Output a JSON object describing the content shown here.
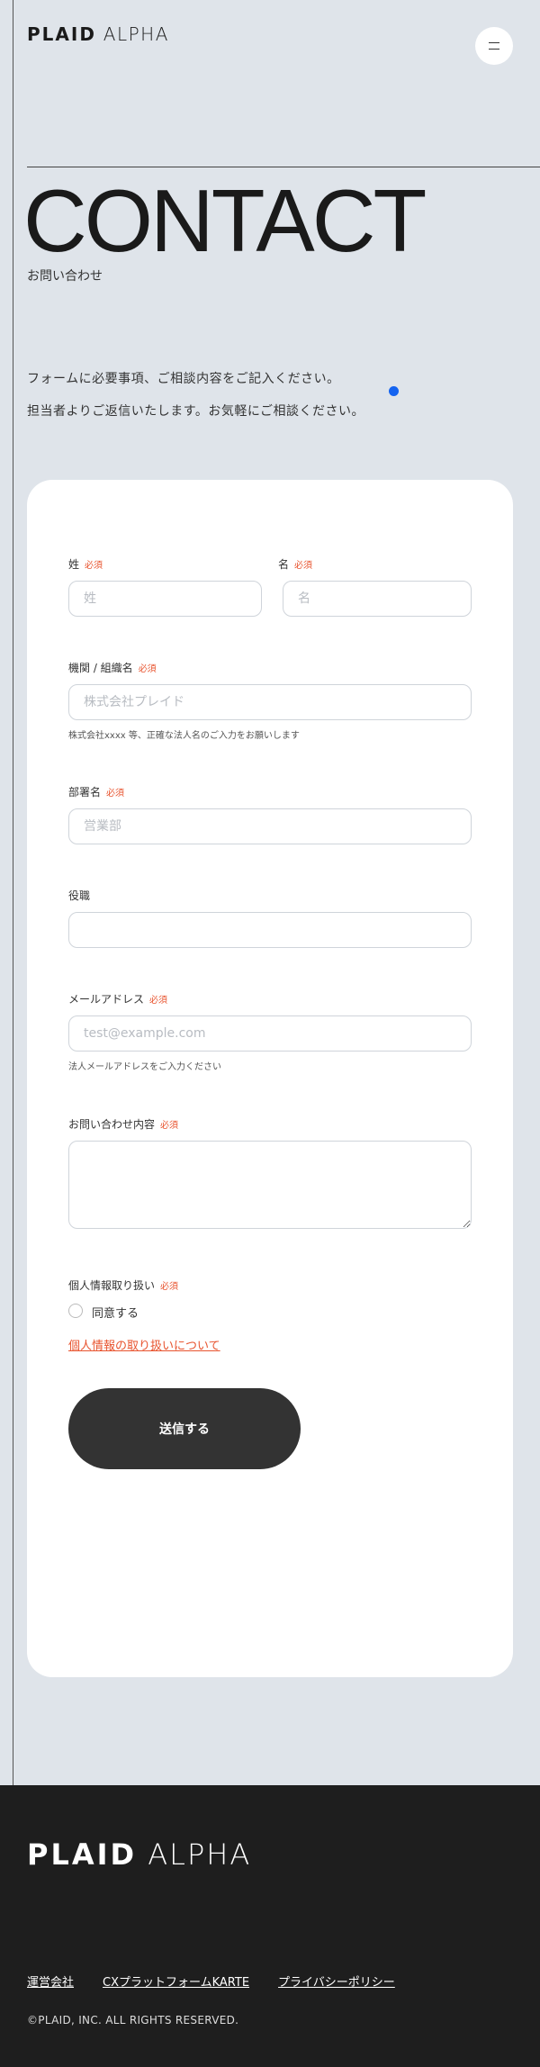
{
  "header": {
    "logo_bold": "PLAID",
    "logo_light": "ALPHA"
  },
  "hero": {
    "title": "CONTACT",
    "subtitle": "お問い合わせ"
  },
  "intro": {
    "line1": "フォームに必要事項、ご相談内容をご記入ください。",
    "line2": "担当者よりご返信いたします。お気軽にご相談ください。"
  },
  "form": {
    "required_label": "必須",
    "last_name": {
      "label": "姓",
      "placeholder": "姓"
    },
    "first_name": {
      "label": "名",
      "placeholder": "名"
    },
    "organization": {
      "label": "機関 / 組織名",
      "placeholder": "株式会社プレイド",
      "hint": "株式会社xxxx 等、正確な法人名のご入力をお願いします"
    },
    "department": {
      "label": "部署名",
      "placeholder": "営業部"
    },
    "position": {
      "label": "役職",
      "placeholder": ""
    },
    "email": {
      "label": "メールアドレス",
      "placeholder": "test@example.com",
      "hint": "法人メールアドレスをご入力ください"
    },
    "inquiry": {
      "label": "お問い合わせ内容",
      "placeholder": ""
    },
    "privacy": {
      "label": "個人情報取り扱い",
      "agree_label": "同意する",
      "link_text": "個人情報の取り扱いについて"
    },
    "submit_label": "送信する"
  },
  "footer": {
    "logo_bold": "PLAID",
    "logo_light": "ALPHA",
    "links": [
      "運営会社",
      "CXプラットフォームKARTE",
      "プライバシーポリシー"
    ],
    "copyright": "©PLAID, INC. ALL RIGHTS RESERVED."
  },
  "colors": {
    "accent": "#e8542f",
    "dot": "#1463f0",
    "background": "#dfe4ea",
    "footer": "#1e1e1e",
    "button": "#333333"
  }
}
